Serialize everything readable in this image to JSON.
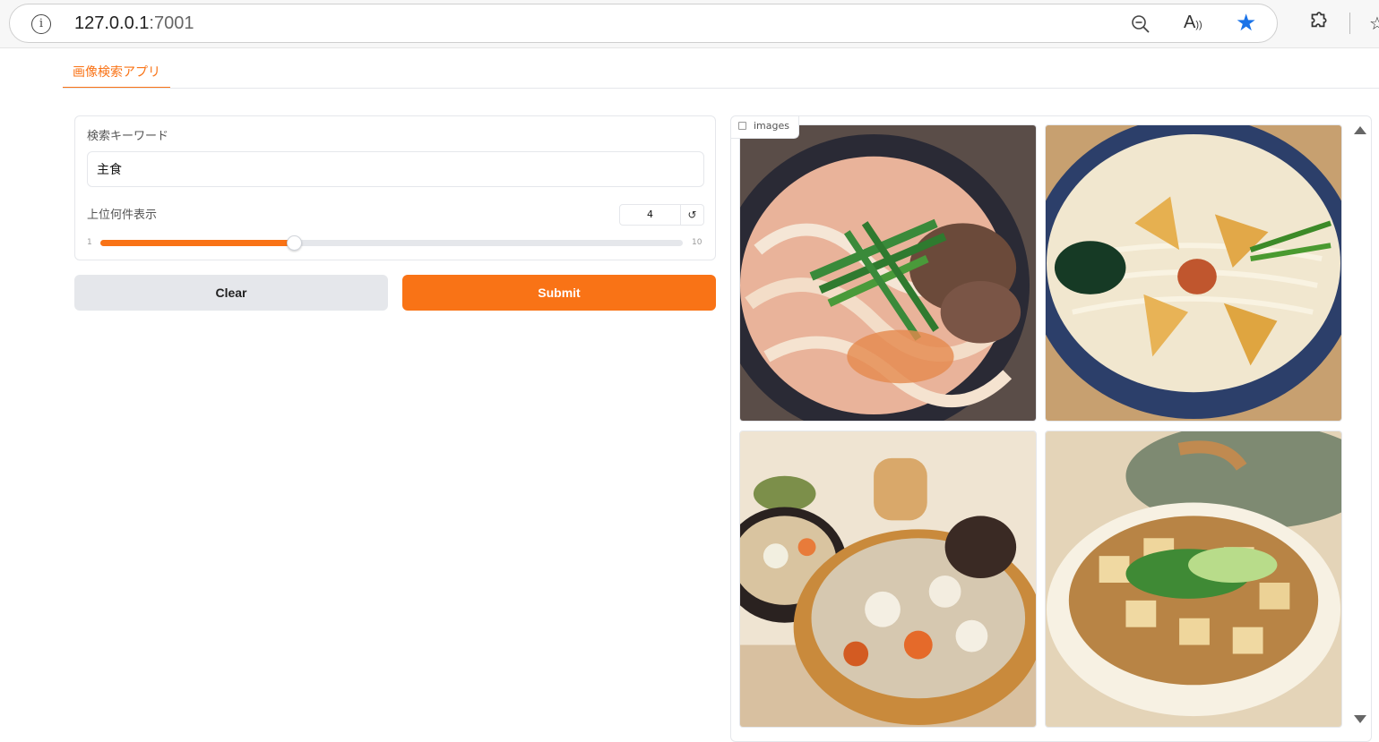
{
  "browser": {
    "url_host": "127.0.0.1",
    "url_port": ":7001",
    "info_icon": "info-icon",
    "zoom_icon": "zoom-out-icon",
    "read_aloud_icon": "read-aloud-icon",
    "favorite_icon": "star-icon",
    "extensions_icon": "puzzle-icon",
    "favorites_bar_icon": "favorites-icon"
  },
  "tab": {
    "label": "画像検索アプリ"
  },
  "form": {
    "keyword_label": "検索キーワード",
    "keyword_value": "主食",
    "topk_label": "上位何件表示",
    "topk_value": "4",
    "topk_min": "1",
    "topk_max": "10",
    "topk_fraction": 0.333,
    "reset_symbol": "↺"
  },
  "buttons": {
    "clear": "Clear",
    "submit": "Submit"
  },
  "gallery": {
    "label": "images",
    "items": [
      "image-1",
      "image-2",
      "image-3",
      "image-4"
    ]
  },
  "colors": {
    "accent": "#f97316",
    "link": "#1a73e8"
  }
}
